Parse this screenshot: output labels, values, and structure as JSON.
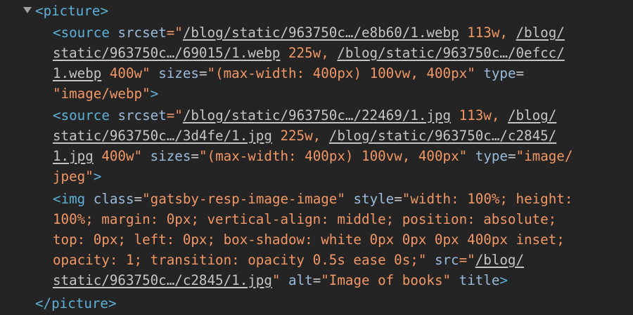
{
  "picture_open": {
    "lt": "<",
    "tag": "picture",
    "gt": ">"
  },
  "picture_close": {
    "lt": "</",
    "tag": "picture",
    "gt": ">"
  },
  "source1": {
    "lt": "<",
    "tag": "source",
    "srcset_attr": "srcset",
    "eqq": "=\"",
    "url1": "/blog/static/963750c…/e8b60/1.webp",
    "w1": " 113w, ",
    "url2a": "/blog/",
    "url2b": "static/963750c…/69015/1.webp",
    "w2": " 225w, ",
    "url3a": "/blog/static/963750c…/0efcc/",
    "url3b": "1.webp",
    "w3": " 400w",
    "q": "\"",
    "sizes_attr": "sizes",
    "sizes_val": "\"(max-width: 400px) 100vw, 400px\"",
    "type_attr": "type",
    "eq": "=",
    "type_val": "\"image/webp\"",
    "gt": ">"
  },
  "source2": {
    "lt": "<",
    "tag": "source",
    "srcset_attr": "srcset",
    "eqq": "=\"",
    "url1": "/blog/static/963750c…/22469/1.jpg",
    "w1": " 113w, ",
    "url2a": "/blog/",
    "url2b": "static/963750c…/3d4fe/1.jpg",
    "w2": " 225w, ",
    "url3a": "/blog/static/963750c…/c2845/",
    "url3b": "1.jpg",
    "w3": " 400w",
    "q": "\"",
    "sizes_attr": "sizes",
    "sizes_val": "\"(max-width: 400px) 100vw, 400px\"",
    "type_attr": "type",
    "eq": "=",
    "type_val_a": "\"image/",
    "type_val_b": "jpeg\"",
    "gt": ">"
  },
  "img": {
    "lt": "<",
    "tag": "img",
    "class_attr": "class",
    "eq": "=",
    "class_val": "\"gatsby-resp-image-image\"",
    "style_attr": "style",
    "style_l1": "\"width: 100%; height:",
    "style_l2": "100%; margin: 0px; vertical-align: middle; position: absolute;",
    "style_l3": "top: 0px; left: 0px; box-shadow: white 0px 0px 0px 400px inset;",
    "style_l4": "opacity: 1; transition: opacity 0.5s ease 0s;\"",
    "src_attr": "src",
    "eqq": "=\"",
    "src_a": "/blog/",
    "src_b": "static/963750c…/c2845/1.jpg",
    "q": "\"",
    "alt_attr": "alt",
    "alt_val": "\"Image of books\"",
    "title_attr": "title",
    "gt": ">"
  }
}
